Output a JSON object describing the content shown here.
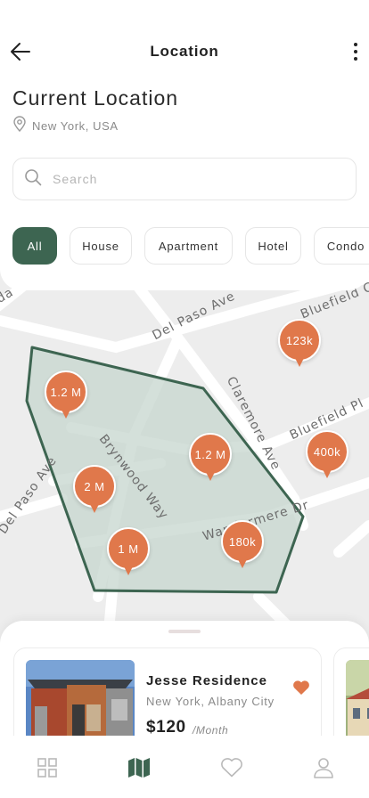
{
  "header": {
    "title": "Location",
    "back_icon": "arrow-left-icon",
    "more_icon": "more-vertical-icon"
  },
  "location": {
    "title": "Current Location",
    "subtitle": "New York, USA",
    "icon": "location-pin-icon"
  },
  "search": {
    "placeholder": "Search",
    "value": "",
    "icon": "search-icon"
  },
  "filters": {
    "selected": "All",
    "items": [
      {
        "label": "All"
      },
      {
        "label": "House"
      },
      {
        "label": "Apartment"
      },
      {
        "label": "Hotel"
      },
      {
        "label": "Condo"
      }
    ]
  },
  "map": {
    "streets": [
      "da",
      "Del Paso Ave",
      "Bluefield C",
      "Claremore Ave",
      "Bluefield Pl",
      "Brynwood Way",
      "Del Paso Ave",
      "Wandermere Dr"
    ],
    "markers": [
      {
        "label": "123k"
      },
      {
        "label": "1.2 M"
      },
      {
        "label": "1.2 M"
      },
      {
        "label": "400k"
      },
      {
        "label": "2 M"
      },
      {
        "label": "1 M"
      },
      {
        "label": "180k"
      }
    ],
    "marker_color": "#e0784b",
    "area_stroke": "#3d6551",
    "area_fill": "#c6d6cd"
  },
  "listing": {
    "name": "Jesse Residence",
    "location": "New York, Albany City",
    "price": "$120",
    "unit": "/Month",
    "favorite_icon": "heart-filled-icon",
    "favorited": true
  },
  "nav": {
    "items": [
      {
        "icon": "grid-icon",
        "active": false
      },
      {
        "icon": "map-icon",
        "active": true
      },
      {
        "icon": "heart-icon",
        "active": false
      },
      {
        "icon": "user-icon",
        "active": false
      }
    ]
  },
  "colors": {
    "primary": "#3d6551",
    "accent": "#e0784b",
    "muted_text": "#8a8a8a"
  }
}
